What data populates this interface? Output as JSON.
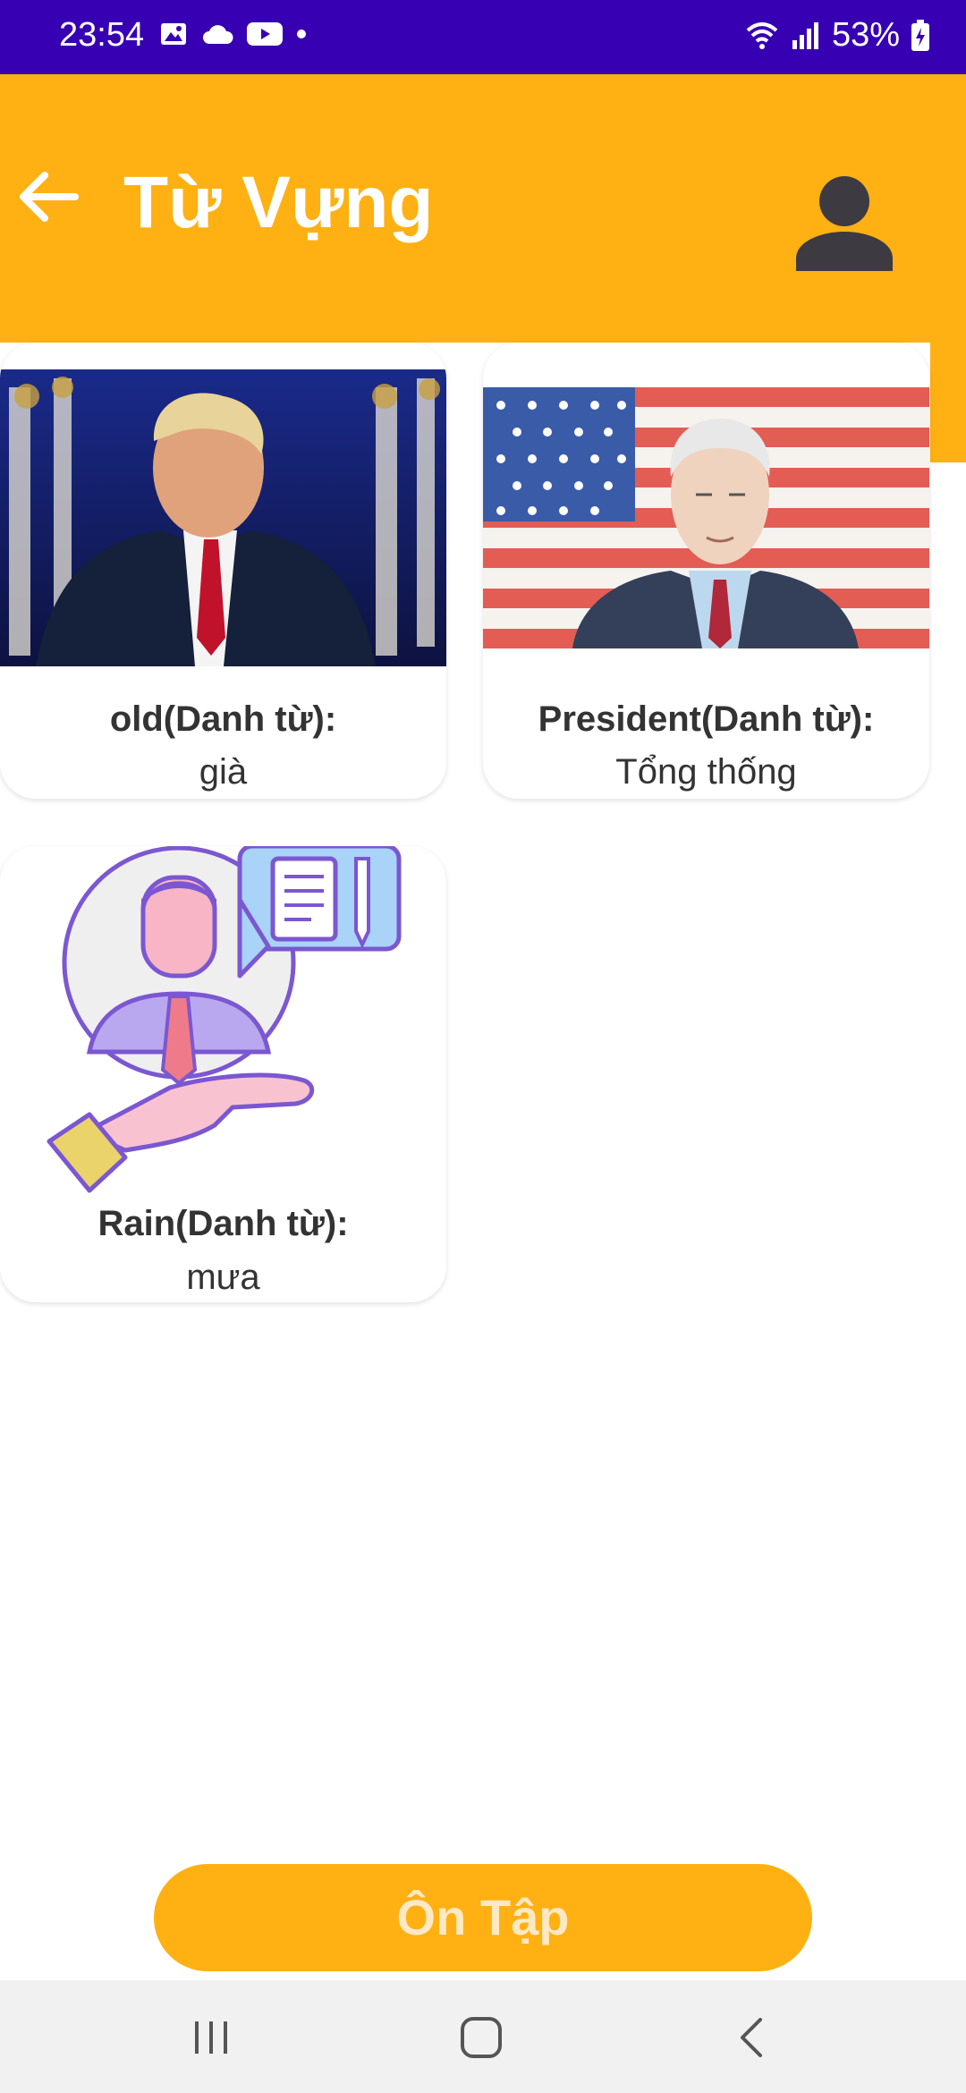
{
  "status_bar": {
    "time": "23:54",
    "battery": "53%",
    "left_icons": [
      "gallery-icon",
      "cloud-icon",
      "youtube-icon",
      "dot-icon"
    ],
    "right_icons": [
      "wifi-icon",
      "signal-icon",
      "battery-icon"
    ]
  },
  "header": {
    "title": "Từ Vựng",
    "back_icon": "arrow-left-icon",
    "profile_icon": "person-icon",
    "color": "#ffb113"
  },
  "vocab": [
    {
      "word": "old(Danh từ):",
      "meaning": "già",
      "image": "photo-man-suit"
    },
    {
      "word": "President(Danh từ):",
      "meaning": "Tổng thống",
      "image": "illustration-president-flag"
    },
    {
      "word": "Rain(Danh từ):",
      "meaning": "mưa",
      "image": "illustration-person-hand"
    }
  ],
  "review_button": {
    "label": "Ôn Tập"
  },
  "nav": {
    "items": [
      "recent-apps-icon",
      "home-icon",
      "back-icon"
    ]
  },
  "colors": {
    "status_bar": "#3700b3",
    "accent": "#ffb113"
  }
}
